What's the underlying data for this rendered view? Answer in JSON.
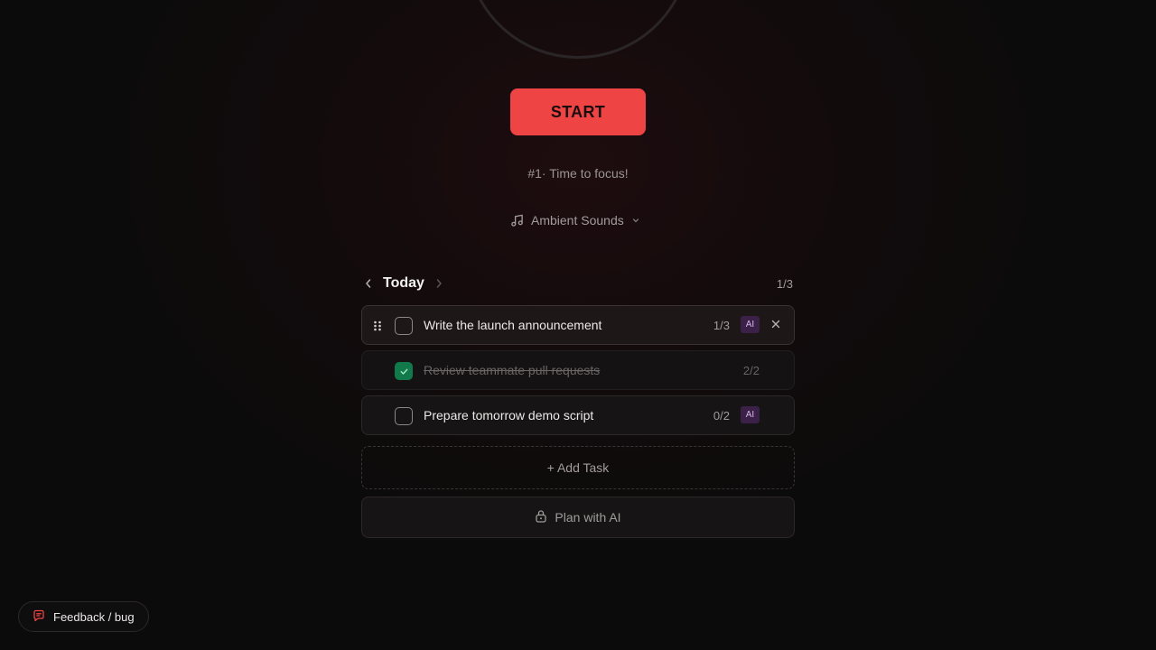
{
  "timer": {
    "start_label": "START",
    "session_label": "#1· Time to focus!"
  },
  "ambient": {
    "label": "Ambient Sounds",
    "icon": "music-note-icon"
  },
  "tasks_panel": {
    "day_label": "Today",
    "progress": "1/3",
    "tasks": [
      {
        "text": "Write the launch announcement",
        "pomodoros": "1/3",
        "ai_badge": "AI",
        "done": false,
        "active": true
      },
      {
        "text": "Review teammate pull requests",
        "pomodoros": "2/2",
        "done": true,
        "active": false
      },
      {
        "text": "Prepare tomorrow demo script",
        "pomodoros": "0/2",
        "ai_badge": "AI",
        "done": false,
        "active": false
      }
    ],
    "add_task_label": "+ Add Task",
    "plan_ai_label": "Plan with AI"
  },
  "feedback": {
    "label": "Feedback / bug"
  },
  "colors": {
    "accent": "#ef4444",
    "done": "#127a4a",
    "ai_badge_bg": "#3b2048"
  }
}
